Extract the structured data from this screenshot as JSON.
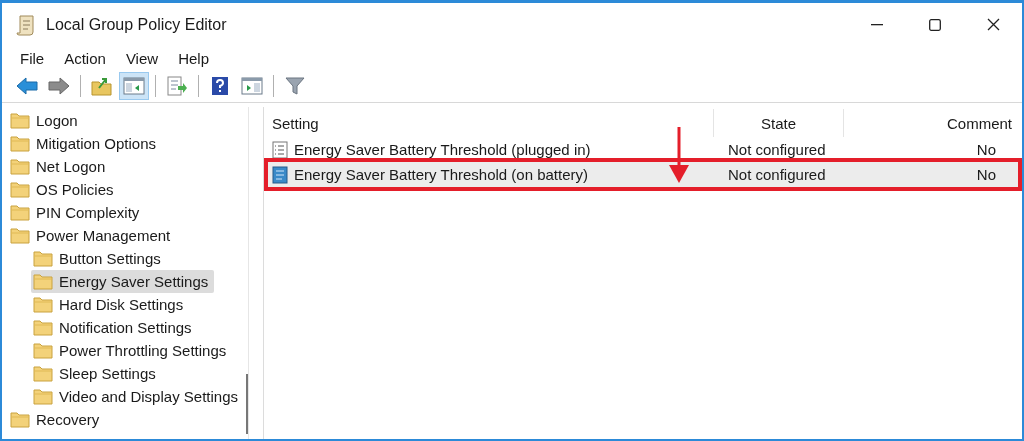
{
  "window": {
    "title": "Local Group Policy Editor"
  },
  "menu": [
    "File",
    "Action",
    "View",
    "Help"
  ],
  "toolbar": [
    {
      "pressed": false
    },
    {
      "pressed": false
    },
    {
      "pressed": false
    },
    {
      "pressed": true
    },
    {
      "pressed": false
    },
    {
      "pressed": false
    },
    {
      "pressed": false
    },
    {
      "pressed": false
    }
  ],
  "tree": [
    {
      "label": "Logon",
      "selected": false
    },
    {
      "label": "Mitigation Options",
      "selected": false
    },
    {
      "label": "Net Logon",
      "selected": false
    },
    {
      "label": "OS Policies",
      "selected": false
    },
    {
      "label": "PIN Complexity",
      "selected": false
    },
    {
      "label": "Power Management",
      "selected": false,
      "children": [
        {
          "label": "Button Settings",
          "selected": false
        },
        {
          "label": "Energy Saver Settings",
          "selected": true
        },
        {
          "label": "Hard Disk Settings",
          "selected": false
        },
        {
          "label": "Notification Settings",
          "selected": false
        },
        {
          "label": "Power Throttling Settings",
          "selected": false
        },
        {
          "label": "Sleep Settings",
          "selected": false
        },
        {
          "label": "Video and Display Settings",
          "selected": false
        }
      ]
    },
    {
      "label": "Recovery",
      "selected": false
    }
  ],
  "table": {
    "columns": [
      "Setting",
      "State",
      "Comment"
    ],
    "rows": [
      {
        "setting": "Energy Saver Battery Threshold (plugged in)",
        "state": "Not configured",
        "comment": "No",
        "selected": false,
        "highlighted": false
      },
      {
        "setting": "Energy Saver Battery Threshold (on battery)",
        "state": "Not configured",
        "comment": "No",
        "selected": true,
        "highlighted": true
      }
    ]
  }
}
